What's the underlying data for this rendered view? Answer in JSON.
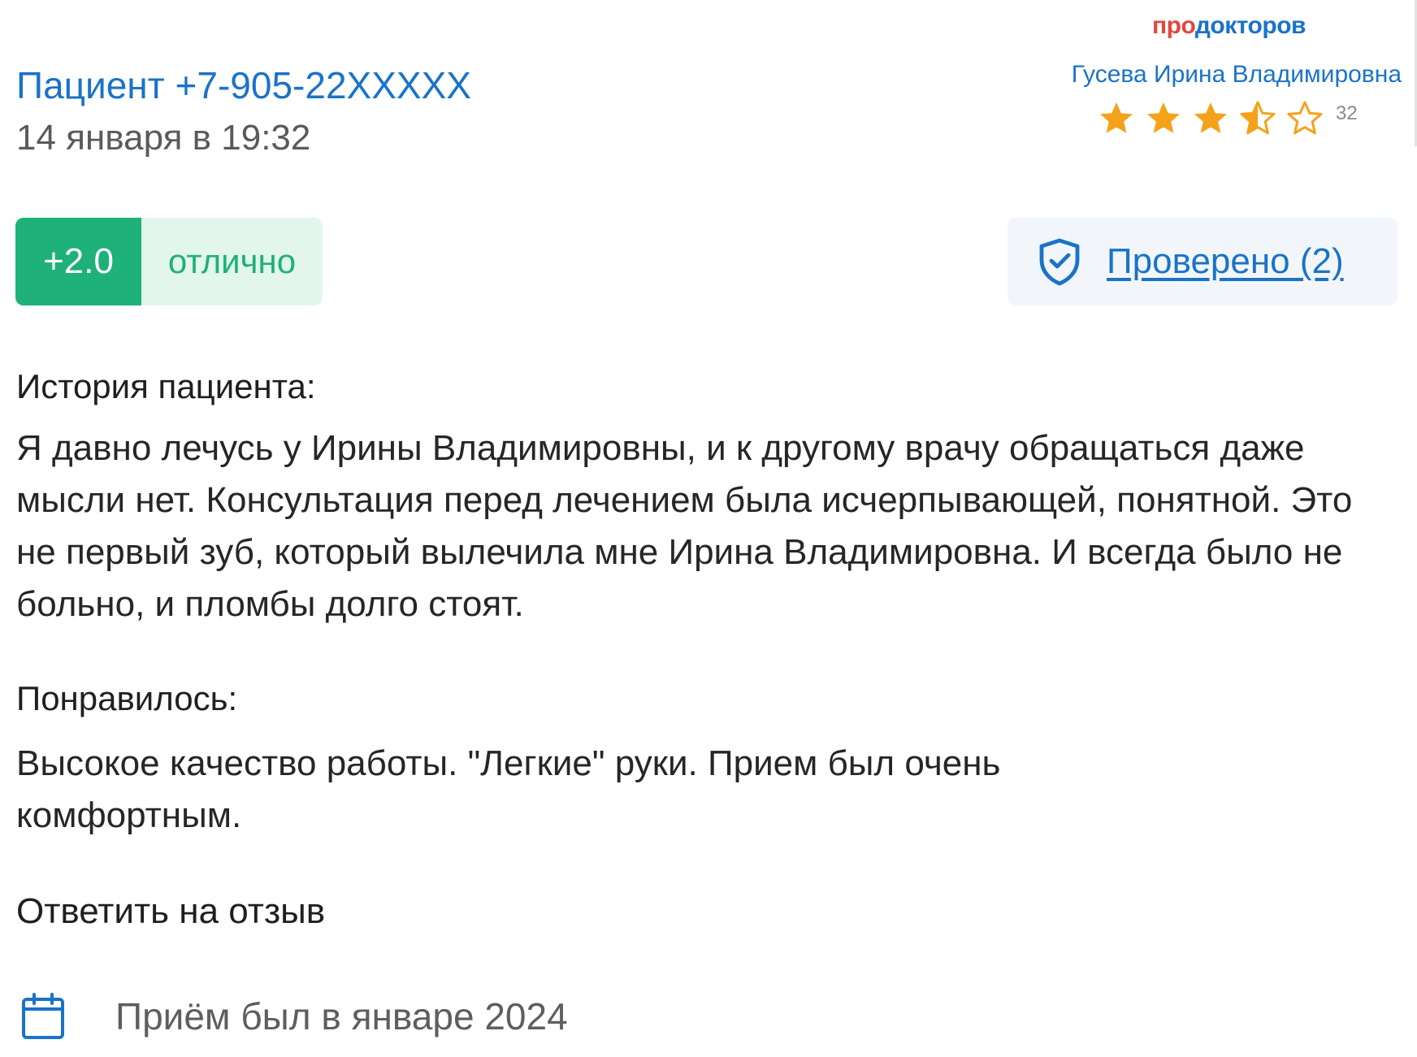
{
  "header": {
    "patient": "Пациент +7-905-22XXXXX",
    "date": "14 января в 19:32"
  },
  "doctor_card": {
    "brand_pro": "про",
    "brand_doc": "докторов",
    "doctor_name": "Гусева Ирина Владимировна",
    "rating_stars": 3.5,
    "reviews_count": "32"
  },
  "rating": {
    "score": "+2.0",
    "label": "отлично"
  },
  "verified": {
    "label": "Проверено (2)"
  },
  "history": {
    "title": "История пациента:",
    "text": "Я давно лечусь у Ирины Владимировны, и к другому врачу обращаться даже мысли нет. Консультация перед лечением была исчерпывающей, понятной. Это не первый зуб, который вылечила мне Ирина Владимировна. И всегда было не больно, и пломбы долго стоят."
  },
  "liked": {
    "title": "Понравилось:",
    "text": "Высокое качество работы. \"Легкие\" руки. Прием был очень комфортным."
  },
  "actions": {
    "reply": "Ответить на отзыв"
  },
  "visit": {
    "text": "Приём был в январе 2024"
  },
  "colors": {
    "link_blue": "#1a73c8",
    "brand_red": "#e2473d",
    "rating_green": "#1eb17a",
    "star_orange": "#f5a21b"
  }
}
